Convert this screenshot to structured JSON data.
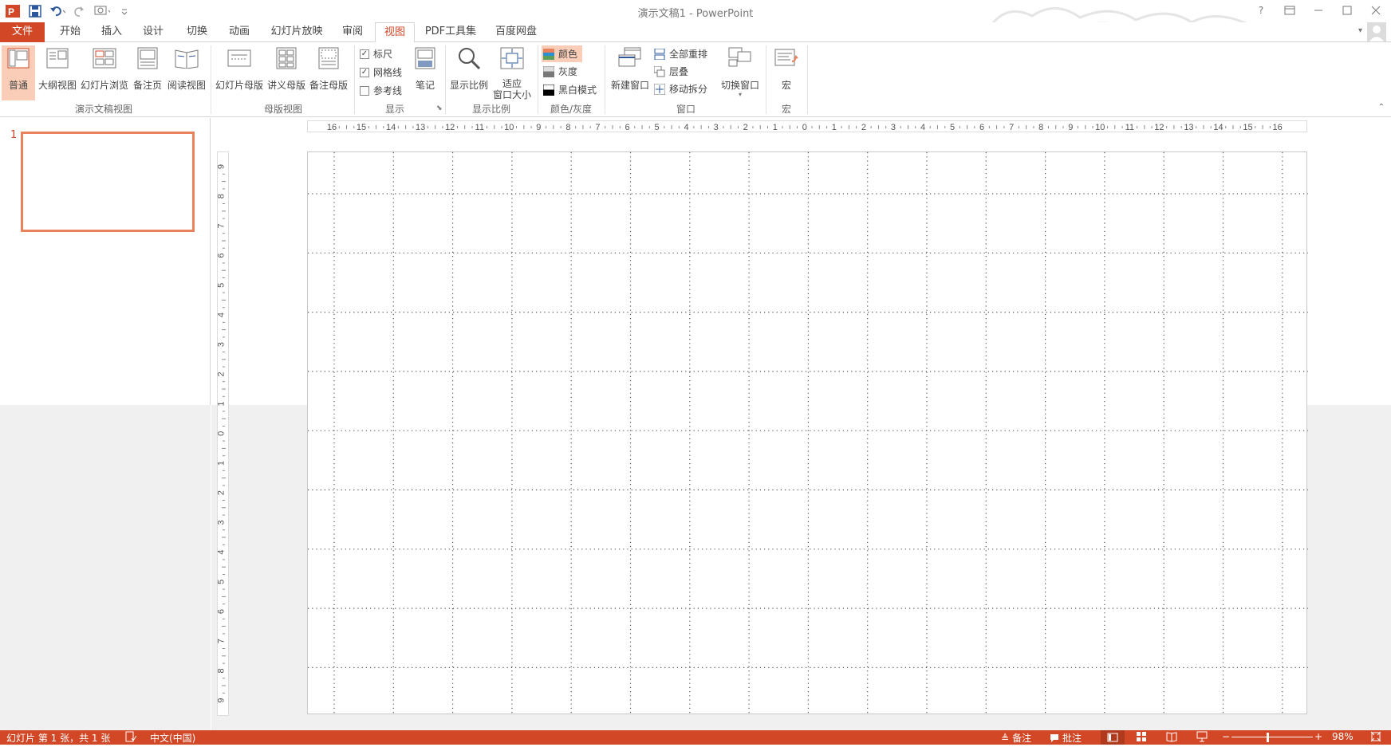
{
  "window": {
    "title": "演示文稿1 - PowerPoint"
  },
  "tabs": [
    {
      "label": "文件"
    },
    {
      "label": "开始"
    },
    {
      "label": "插入"
    },
    {
      "label": "设计"
    },
    {
      "label": "切换"
    },
    {
      "label": "动画"
    },
    {
      "label": "幻灯片放映"
    },
    {
      "label": "审阅"
    },
    {
      "label": "视图"
    },
    {
      "label": "PDF工具集"
    },
    {
      "label": "百度网盘"
    }
  ],
  "ribbon": {
    "presentation_views": {
      "group_label": "演示文稿视图",
      "normal": "普通",
      "outline": "大纲视图",
      "slide_sorter": "幻灯片浏览",
      "notes_page": "备注页",
      "reading": "阅读视图"
    },
    "master_views": {
      "group_label": "母版视图",
      "slide_master": "幻灯片母版",
      "handout_master": "讲义母版",
      "notes_master": "备注母版"
    },
    "show": {
      "group_label": "显示",
      "ruler": "标尺",
      "gridlines": "网格线",
      "guides": "参考线",
      "notes": "笔记",
      "ruler_checked": true,
      "gridlines_checked": true,
      "guides_checked": false
    },
    "zoom": {
      "group_label": "显示比例",
      "zoom": "显示比例",
      "fit_line1": "适应",
      "fit_line2": "窗口大小"
    },
    "color": {
      "group_label": "颜色/灰度",
      "color": "颜色",
      "grayscale": "灰度",
      "bw": "黑白模式"
    },
    "window": {
      "group_label": "窗口",
      "new_window": "新建窗口",
      "arrange_all": "全部重排",
      "cascade": "层叠",
      "move_split": "移动拆分",
      "switch_windows": "切换窗口"
    },
    "macros": {
      "group_label": "宏",
      "macros": "宏"
    }
  },
  "thumbnails": [
    {
      "number": "1"
    }
  ],
  "hruler_labels": [
    "16",
    "15",
    "14",
    "13",
    "12",
    "11",
    "10",
    "9",
    "8",
    "7",
    "6",
    "5",
    "4",
    "3",
    "2",
    "1",
    "0",
    "1",
    "2",
    "3",
    "4",
    "5",
    "6",
    "7",
    "8",
    "9",
    "10",
    "11",
    "12",
    "13",
    "14",
    "15",
    "16"
  ],
  "vruler_labels": [
    "9",
    "8",
    "7",
    "6",
    "5",
    "4",
    "3",
    "2",
    "1",
    "0",
    "1",
    "2",
    "3",
    "4",
    "5",
    "6",
    "7",
    "8",
    "9"
  ],
  "status": {
    "slide_info": "幻灯片 第 1 张，共 1 张",
    "language": "中文(中国)",
    "notes": "备注",
    "comments": "批注",
    "zoom_pct": "98%"
  },
  "colors": {
    "accent": "#d24726",
    "selected": "#f9cdb7"
  }
}
